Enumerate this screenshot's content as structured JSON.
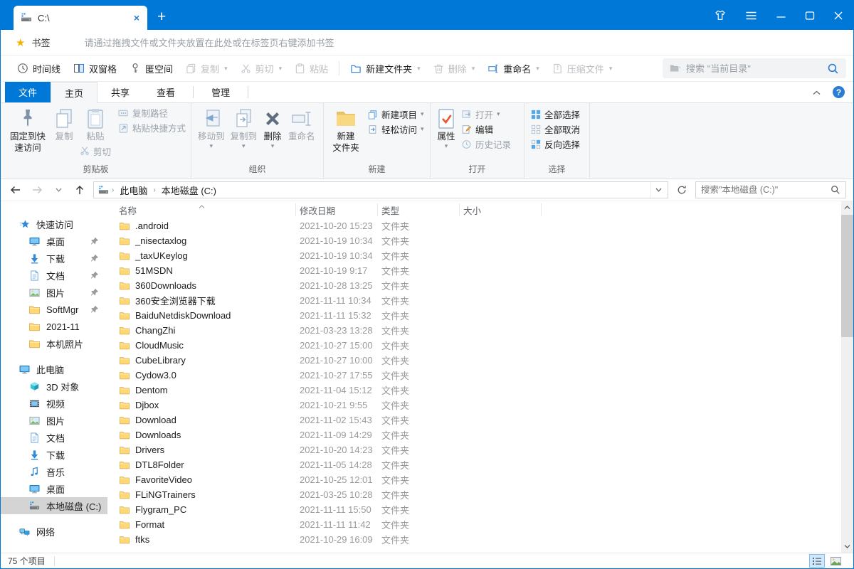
{
  "window": {
    "tab_title": "C:\\",
    "controls": [
      "theme",
      "menu",
      "minimize",
      "maximize",
      "close"
    ]
  },
  "bookmarks": {
    "label": "书签",
    "hint": "请通过拖拽文件或文件夹放置在此处或在标签页右键添加书签"
  },
  "toolbar": {
    "timeline": "时间线",
    "dual_pane": "双窗格",
    "hidden_space": "匿空间",
    "copy": "复制",
    "cut": "剪切",
    "paste": "粘贴",
    "new_folder": "新建文件夹",
    "delete": "删除",
    "rename": "重命名",
    "compress": "压缩文件",
    "search_placeholder": "搜索 \"当前目录\""
  },
  "ribbon": {
    "tabs": [
      "文件",
      "主页",
      "共享",
      "查看",
      "管理"
    ],
    "groups": {
      "clipboard": {
        "label": "剪贴板",
        "pin_line1": "固定到快",
        "pin_line2": "速访问",
        "copy": "复制",
        "paste": "粘贴",
        "cut": "剪切",
        "copy_path": "复制路径",
        "paste_shortcut": "粘贴快捷方式"
      },
      "organize": {
        "label": "组织",
        "move_to": "移动到",
        "copy_to": "复制到",
        "delete": "删除",
        "rename": "重命名"
      },
      "new": {
        "label": "新建",
        "new_folder_line1": "新建",
        "new_folder_line2": "文件夹",
        "new_item": "新建项目",
        "easy_access": "轻松访问"
      },
      "open": {
        "label": "打开",
        "properties": "属性",
        "open": "打开",
        "edit": "编辑",
        "history": "历史记录"
      },
      "select": {
        "label": "选择",
        "select_all": "全部选择",
        "select_none": "全部取消",
        "invert": "反向选择"
      }
    }
  },
  "address": {
    "crumbs": [
      "此电脑",
      "本地磁盘 (C:)"
    ],
    "search_placeholder": "搜索\"本地磁盘 (C:)\""
  },
  "sidebar": {
    "sections": [
      {
        "label": "快速访问",
        "children": [
          {
            "label": "桌面",
            "pinned": true
          },
          {
            "label": "下载",
            "pinned": true
          },
          {
            "label": "文档",
            "pinned": true
          },
          {
            "label": "图片",
            "pinned": true
          },
          {
            "label": "SoftMgr",
            "pinned": true
          },
          {
            "label": "2021-11",
            "pinned": false
          },
          {
            "label": "本机照片",
            "pinned": false
          }
        ]
      },
      {
        "label": "此电脑",
        "children": [
          {
            "label": "3D 对象"
          },
          {
            "label": "视频"
          },
          {
            "label": "图片"
          },
          {
            "label": "文档"
          },
          {
            "label": "下载"
          },
          {
            "label": "音乐"
          },
          {
            "label": "桌面"
          },
          {
            "label": "本地磁盘 (C:)",
            "selected": true
          }
        ]
      },
      {
        "label": "网络",
        "children": []
      }
    ]
  },
  "files": {
    "columns": [
      "名称",
      "修改日期",
      "类型",
      "大小"
    ],
    "rows": [
      {
        "name": ".android",
        "modified": "2021-10-20 15:23",
        "type": "文件夹",
        "size": ""
      },
      {
        "name": "_nisectaxlog",
        "modified": "2021-10-19 10:34",
        "type": "文件夹",
        "size": ""
      },
      {
        "name": "_taxUKeylog",
        "modified": "2021-10-19 10:34",
        "type": "文件夹",
        "size": ""
      },
      {
        "name": "51MSDN",
        "modified": "2021-10-19 9:17",
        "type": "文件夹",
        "size": ""
      },
      {
        "name": "360Downloads",
        "modified": "2021-10-28 13:25",
        "type": "文件夹",
        "size": ""
      },
      {
        "name": "360安全浏览器下载",
        "modified": "2021-11-11 10:34",
        "type": "文件夹",
        "size": ""
      },
      {
        "name": "BaiduNetdiskDownload",
        "modified": "2021-11-11 15:32",
        "type": "文件夹",
        "size": ""
      },
      {
        "name": "ChangZhi",
        "modified": "2021-03-23 13:28",
        "type": "文件夹",
        "size": ""
      },
      {
        "name": "CloudMusic",
        "modified": "2021-10-27 15:00",
        "type": "文件夹",
        "size": ""
      },
      {
        "name": "CubeLibrary",
        "modified": "2021-10-27 10:00",
        "type": "文件夹",
        "size": ""
      },
      {
        "name": "Cydow3.0",
        "modified": "2021-10-27 17:55",
        "type": "文件夹",
        "size": ""
      },
      {
        "name": "Dentom",
        "modified": "2021-11-04 15:12",
        "type": "文件夹",
        "size": ""
      },
      {
        "name": "Djbox",
        "modified": "2021-10-21 9:55",
        "type": "文件夹",
        "size": ""
      },
      {
        "name": "Download",
        "modified": "2021-11-02 15:43",
        "type": "文件夹",
        "size": ""
      },
      {
        "name": "Downloads",
        "modified": "2021-11-09 14:29",
        "type": "文件夹",
        "size": ""
      },
      {
        "name": "Drivers",
        "modified": "2021-10-20 14:23",
        "type": "文件夹",
        "size": ""
      },
      {
        "name": "DTL8Folder",
        "modified": "2021-11-05 14:28",
        "type": "文件夹",
        "size": ""
      },
      {
        "name": "FavoriteVideo",
        "modified": "2021-10-25 12:01",
        "type": "文件夹",
        "size": ""
      },
      {
        "name": "FLiNGTrainers",
        "modified": "2021-03-25 10:28",
        "type": "文件夹",
        "size": ""
      },
      {
        "name": "Flygram_PC",
        "modified": "2021-11-11 15:50",
        "type": "文件夹",
        "size": ""
      },
      {
        "name": "Format",
        "modified": "2021-11-11 11:42",
        "type": "文件夹",
        "size": ""
      },
      {
        "name": "ftks",
        "modified": "2021-10-29 16:09",
        "type": "文件夹",
        "size": ""
      }
    ]
  },
  "statusbar": {
    "items_count": "75 个项目"
  },
  "colors": {
    "accent": "#0078d7",
    "folder": "#ffd875",
    "disabled": "#b9c0c7",
    "sidebar_selection": "#d4d4d4"
  }
}
